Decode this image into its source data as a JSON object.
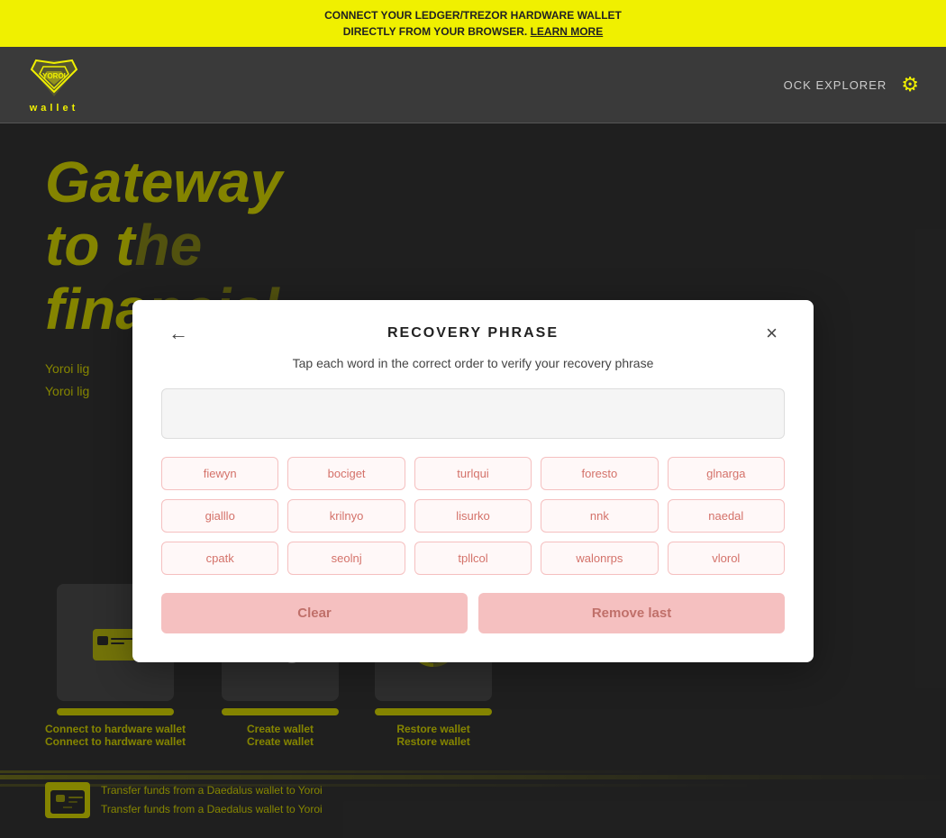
{
  "announcement": {
    "line1": "CONNECT YOUR LEDGER/TREZOR HARDWARE WALLET",
    "line2": "DIRECTLY FROM YOUR BROWSER. LEARN MORE",
    "link_text": "LEARN MORE"
  },
  "header": {
    "logo_text": "wallet",
    "explorer_label": "OCK EXPLORER"
  },
  "hero": {
    "heading_line1": "Gateway",
    "heading_line2": "to t",
    "heading_line3": "to t",
    "heading_line4": "fina",
    "heading_line5": "fina",
    "sub_line1": "Yoroi lig",
    "sub_line2": "Yoroi lig"
  },
  "cards": [
    {
      "label_line1": "Connect to hardware wallet",
      "label_line2": "Connect to hardware wallet"
    },
    {
      "label_line1": "Create wallet",
      "label_line2": "Create wallet"
    },
    {
      "label_line1": "Restore wallet",
      "label_line2": "Restore wallet"
    }
  ],
  "transfer": {
    "text_line1": "Transfer funds from a Daedalus wallet to Yoroi",
    "text_line2": "Transfer funds from a Daedalus wallet to Yoroi"
  },
  "modal": {
    "title": "RECOVERY PHRASE",
    "subtitle": "Tap each word in the correct order to verify your recovery phrase",
    "back_label": "←",
    "close_label": "×",
    "words": [
      "fiewyn",
      "bociget",
      "turlqui",
      "foresto",
      "glnarga",
      "gialllo",
      "krilnyo",
      "lisurko",
      "nnk",
      "naedal",
      "cpatk",
      "seolnj",
      "tpllcol",
      "walonrps",
      "vlorol"
    ],
    "btn_clear": "Clear",
    "btn_remove_last": "Remove last"
  }
}
